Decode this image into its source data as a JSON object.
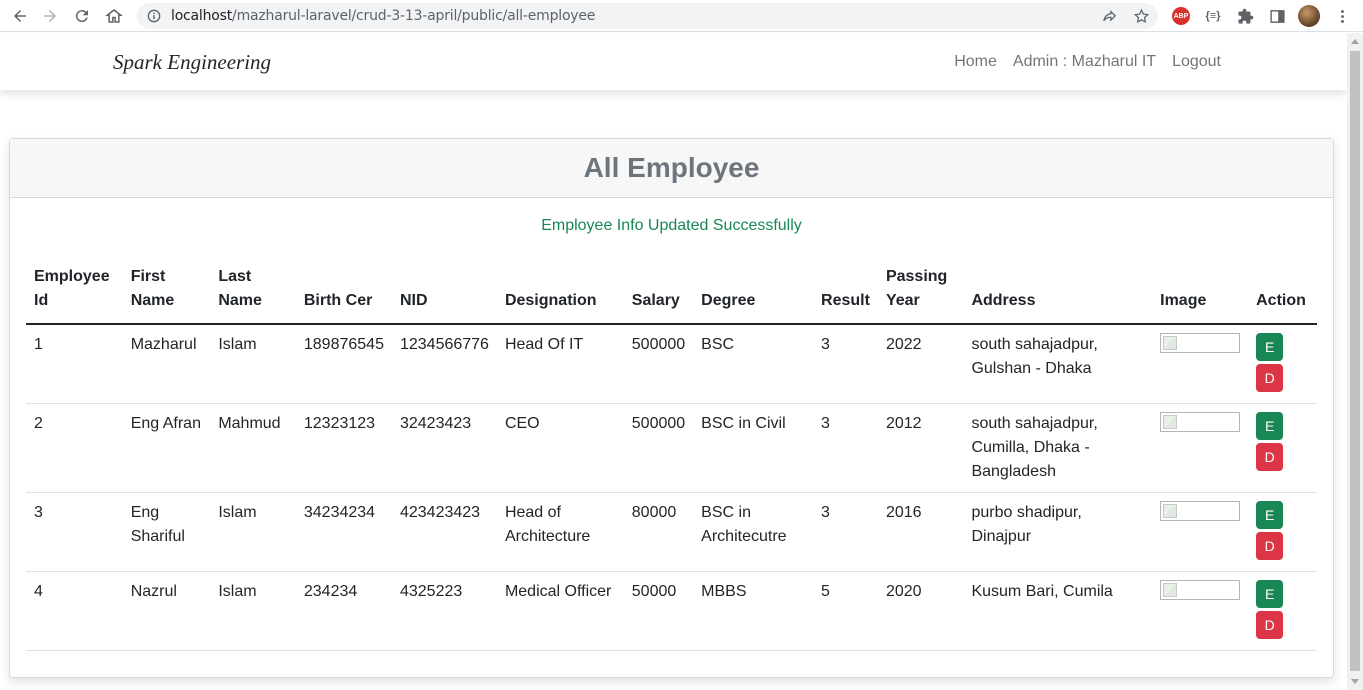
{
  "browser": {
    "url_host": "localhost",
    "url_path": "/mazharul-laravel/crud-3-13-april/public/all-employee",
    "abp_label": "ABP"
  },
  "navbar": {
    "brand": "Spark Engineering",
    "links": [
      "Home",
      "Admin : Mazharul IT",
      "Logout"
    ]
  },
  "card": {
    "title": "All Employee",
    "message": "Employee Info Updated Successfully"
  },
  "table": {
    "headers": [
      "Employee Id",
      "First Name",
      "Last Name",
      "Birth Cer",
      "NID",
      "Designation",
      "Salary",
      "Degree",
      "Result",
      "Passing Year",
      "Address",
      "Image",
      "Action"
    ],
    "rows": [
      [
        "1",
        "Mazharul",
        "Islam",
        "189876545",
        "1234566776",
        "Head Of IT",
        "500000",
        "BSC",
        "3",
        "2022",
        "south sahajadpur, Gulshan - Dhaka"
      ],
      [
        "2",
        "Eng Afran",
        "Mahmud",
        "12323123",
        "32423423",
        "CEO",
        "500000",
        "BSC in Civil",
        "3",
        "2012",
        "south sahajadpur, Cumilla, Dhaka - Bangladesh"
      ],
      [
        "3",
        "Eng Shariful",
        "Islam",
        "34234234",
        "423423423",
        "Head of Architecture",
        "80000",
        "BSC in Architecutre",
        "3",
        "2016",
        "purbo shadipur, Dinajpur"
      ],
      [
        "4",
        "Nazrul",
        "Islam",
        "234234",
        "4325223",
        "Medical Officer",
        "50000",
        "MBBS",
        "5",
        "2020",
        "Kusum Bari, Cumila"
      ]
    ],
    "edit_label": "E",
    "delete_label": "D"
  },
  "colors": {
    "success": "#198754",
    "danger": "#dc3545",
    "header_text": "#6c757d"
  }
}
